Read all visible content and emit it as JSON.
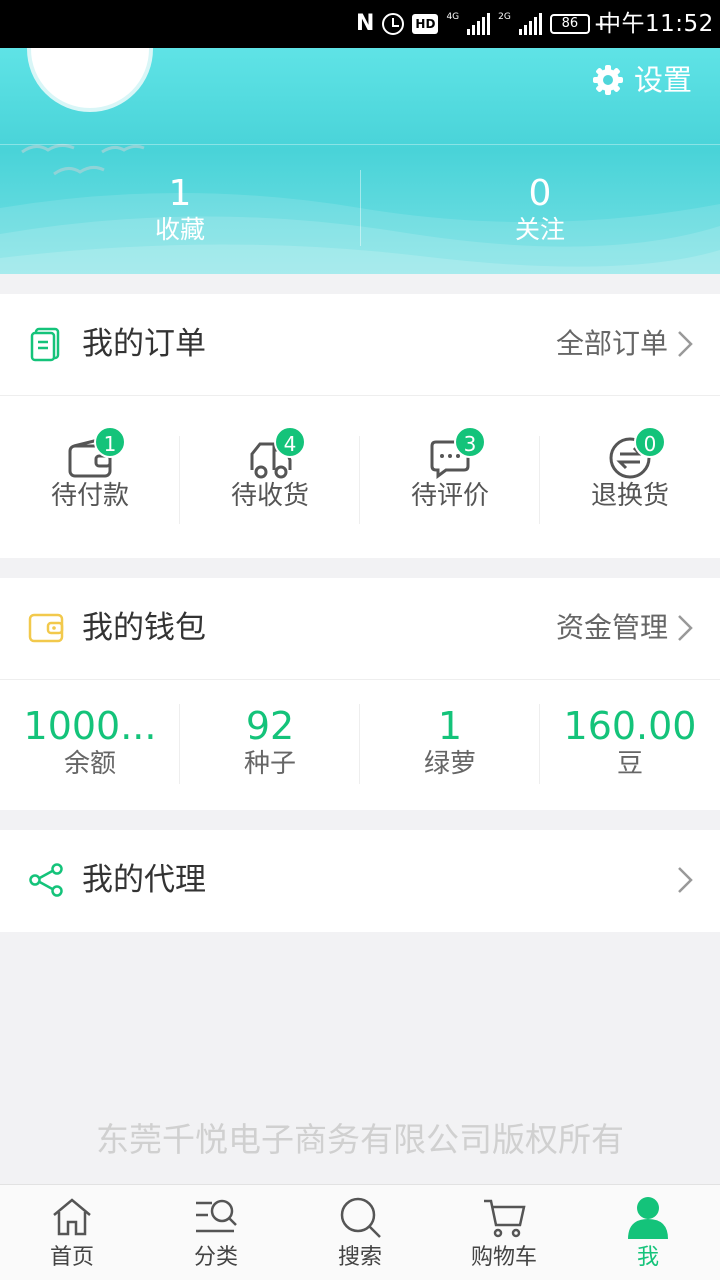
{
  "status_bar": {
    "nfc": "N",
    "hd": "HD",
    "net1": "4G",
    "net2": "2G",
    "battery": "86",
    "time": "中午11:52"
  },
  "header": {
    "settings_label": "设置",
    "stats": [
      {
        "value": "1",
        "label": "收藏"
      },
      {
        "value": "0",
        "label": "关注"
      }
    ]
  },
  "orders": {
    "title": "我的订单",
    "link": "全部订单",
    "items": [
      {
        "label": "待付款",
        "badge": "1",
        "icon": "wallet-icon"
      },
      {
        "label": "待收货",
        "badge": "4",
        "icon": "truck-icon"
      },
      {
        "label": "待评价",
        "badge": "3",
        "icon": "comment-icon"
      },
      {
        "label": "退换货",
        "badge": "0",
        "icon": "exchange-icon"
      }
    ]
  },
  "wallet": {
    "title": "我的钱包",
    "link": "资金管理",
    "items": [
      {
        "value": "1000...",
        "label": "余额"
      },
      {
        "value": "92",
        "label": "种子"
      },
      {
        "value": "1",
        "label": "绿萝"
      },
      {
        "value": "160.00",
        "label": "豆"
      }
    ]
  },
  "agent": {
    "title": "我的代理"
  },
  "copyright": "东莞千悦电子商务有限公司版权所有",
  "tabs": [
    {
      "label": "首页",
      "icon": "home-icon"
    },
    {
      "label": "分类",
      "icon": "category-icon"
    },
    {
      "label": "搜索",
      "icon": "search-icon"
    },
    {
      "label": "购物车",
      "icon": "cart-icon"
    },
    {
      "label": "我",
      "icon": "user-icon"
    }
  ],
  "colors": {
    "accent": "#14c37a",
    "header": "#49d3d8",
    "wallet_icon": "#f2c94c"
  }
}
